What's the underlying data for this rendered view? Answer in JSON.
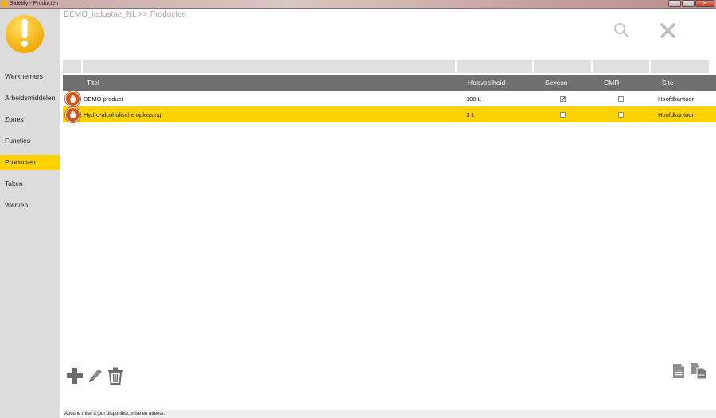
{
  "window": {
    "title": "Safetify - Producten"
  },
  "breadcrumb": "DEMO_industrie_NL >> Producten",
  "sidebar": {
    "items": [
      {
        "label": "Werknemers"
      },
      {
        "label": "Arbeidsmiddelen"
      },
      {
        "label": "Zones"
      },
      {
        "label": "Functies"
      },
      {
        "label": "Producten"
      },
      {
        "label": "Taken"
      },
      {
        "label": "Werven"
      }
    ],
    "active_index": 4,
    "active_color": "#ffd200"
  },
  "table": {
    "columns": [
      "Titel",
      "Hoeveelheid",
      "Seveso",
      "CMR",
      "Site"
    ],
    "rows": [
      {
        "title": "DEMO product",
        "quantity": "100 L",
        "seveso": true,
        "cmr": false,
        "site": "Hoofdkantoor",
        "selected": false
      },
      {
        "title": "Hydro-alcoholische oplossing",
        "quantity": "1 L",
        "seveso": false,
        "cmr": false,
        "site": "Hoofdkantoor",
        "selected": true
      }
    ]
  },
  "icons": {
    "logo": "warning-exclamation-icon",
    "row_marker": "stop-hand-icon",
    "top_actions": [
      "search-icon",
      "close-icon"
    ],
    "bottom_left": [
      "add-icon",
      "edit-pencil-icon",
      "trash-icon"
    ],
    "bottom_right": [
      "document-icon",
      "copy-documents-icon"
    ]
  },
  "status": "Aucune mise à jour disponible, mise en attente.",
  "colors": {
    "accent": "#ffd200",
    "header": "#6f6f6f",
    "sidebar": "#dcdcdc",
    "stop": "#d2561c"
  }
}
